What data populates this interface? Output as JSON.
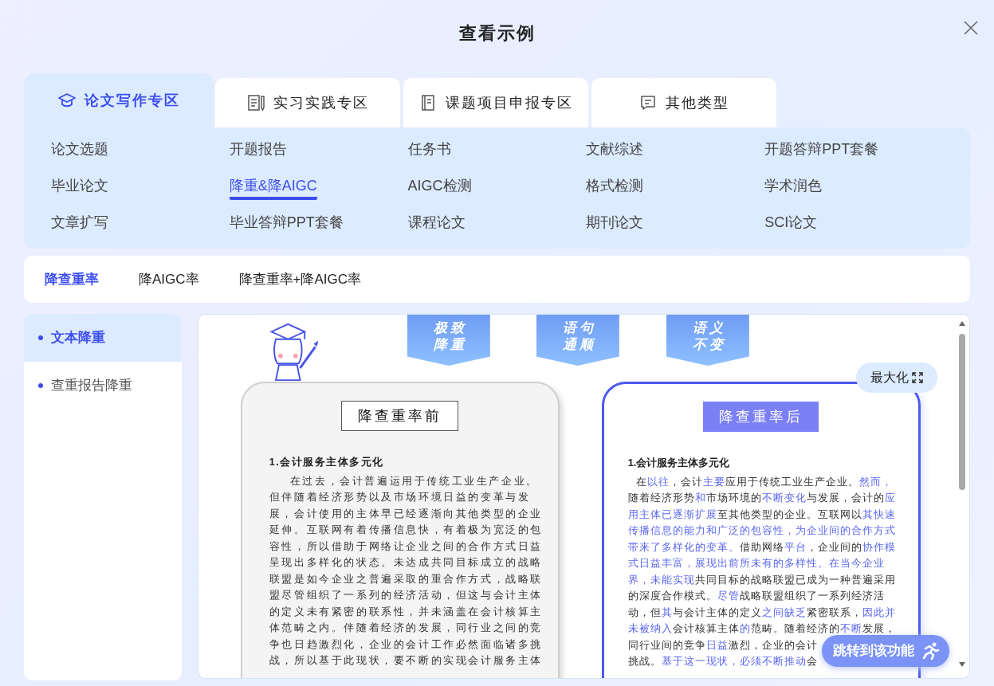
{
  "dialog": {
    "title": "查看示例"
  },
  "tabs": [
    {
      "label": "论文写作专区",
      "kind": "cap",
      "selected": true
    },
    {
      "label": "实习实践专区",
      "kind": "doc",
      "selected": false
    },
    {
      "label": "课题项目申报专区",
      "kind": "book",
      "selected": false
    },
    {
      "label": "其他类型",
      "kind": "chat",
      "selected": false
    }
  ],
  "categories": [
    {
      "label": "论文选题",
      "selected": false
    },
    {
      "label": "开题报告",
      "selected": false
    },
    {
      "label": "任务书",
      "selected": false
    },
    {
      "label": "文献综述",
      "selected": false
    },
    {
      "label": "开题答辩PPT套餐",
      "selected": false
    },
    {
      "label": "毕业论文",
      "selected": false
    },
    {
      "label": "降重&降AIGC",
      "selected": true
    },
    {
      "label": "AIGC检测",
      "selected": false
    },
    {
      "label": "格式检测",
      "selected": false
    },
    {
      "label": "学术润色",
      "selected": false
    },
    {
      "label": "文章扩写",
      "selected": false
    },
    {
      "label": "毕业答辩PPT套餐",
      "selected": false
    },
    {
      "label": "课程论文",
      "selected": false
    },
    {
      "label": "期刊论文",
      "selected": false
    },
    {
      "label": "SCI论文",
      "selected": false
    }
  ],
  "sub_tabs": [
    {
      "label": "降查重率",
      "selected": true
    },
    {
      "label": "降AIGC率",
      "selected": false
    },
    {
      "label": "降查重率+降AIGC率",
      "selected": false
    }
  ],
  "sidebar": {
    "items": [
      {
        "label": "文本降重",
        "selected": true
      },
      {
        "label": "查重报告降重",
        "selected": false
      }
    ]
  },
  "preview": {
    "banners": [
      "极致降重",
      "语句通顺",
      "语义不变"
    ],
    "maximize_button": "最大化",
    "before": {
      "title": "降查重率前",
      "heading": "1.会计服务主体多元化",
      "paragraph": "在过去，会计普遍运用于传统工业生产企业。但伴随着经济形势以及市场环境日益的变革与发展，会计使用的主体早已经逐渐向其他类型的企业延伸。互联网有着传播信息快，有着极为宽泛的包容性，所以借助于网络让企业之间的合作方式日益呈现出多样化的状态。未达成共同目标成立的战略联盟是如今企业之普遍采取的重合作方式，战略联盟尽管组织了一系列的经济活动，但这与会计主体的定义未有紧密的联系性，并未涵盖在会计核算主体范畴之内。伴随着经济的发展，同行业之间的竞争也日趋激烈化，企业的会计工作必然面临诸多挑战，所以基于此现状，要不断的实现会计服务主体"
    },
    "after": {
      "title": "降查重率后",
      "heading": "1.会计服务主体多元化",
      "lines": [
        [
          {
            "text": "在",
            "changed": false
          },
          {
            "text": "以往",
            "changed": true
          },
          {
            "text": "，会计",
            "changed": false
          },
          {
            "text": "主要",
            "changed": true
          },
          {
            "text": "应用于传统工业生产企业。",
            "changed": false
          },
          {
            "text": "然而，",
            "changed": true
          }
        ],
        [
          {
            "text": "随着经济形势",
            "changed": false
          },
          {
            "text": "和",
            "changed": true
          },
          {
            "text": "市场环境的",
            "changed": false
          },
          {
            "text": "不断变化",
            "changed": true
          },
          {
            "text": "与发展，会计的",
            "changed": false
          },
          {
            "text": "应",
            "changed": true
          }
        ],
        [
          {
            "text": "用主体已逐渐扩展",
            "changed": true
          },
          {
            "text": "至其他类型的企业。互联网以",
            "changed": false
          },
          {
            "text": "其快速",
            "changed": true
          }
        ],
        [
          {
            "text": "传播信息的能力和广泛的包容性，为企业间的合作方式",
            "changed": true
          }
        ],
        [
          {
            "text": "带来了多样化的变革。",
            "changed": true
          },
          {
            "text": "借助网络",
            "changed": false
          },
          {
            "text": "平台",
            "changed": true
          },
          {
            "text": "，企业间的",
            "changed": false
          },
          {
            "text": "协作模",
            "changed": true
          }
        ],
        [
          {
            "text": "式日益丰富，展现出前所未有的多样性。在当今企业",
            "changed": true
          }
        ],
        [
          {
            "text": "界，未能实现",
            "changed": true
          },
          {
            "text": "共同目标的战略联盟已成为一种普遍采用",
            "changed": false
          }
        ],
        [
          {
            "text": "的深度合作模式。",
            "changed": false
          },
          {
            "text": "尽管",
            "changed": true
          },
          {
            "text": "战略联盟组织了一系列经济活",
            "changed": false
          }
        ],
        [
          {
            "text": "动，但",
            "changed": false
          },
          {
            "text": "其",
            "changed": true
          },
          {
            "text": "与会计主体的定义",
            "changed": false
          },
          {
            "text": "之间缺乏",
            "changed": true
          },
          {
            "text": "紧密联系，",
            "changed": false
          },
          {
            "text": "因此并",
            "changed": true
          }
        ],
        [
          {
            "text": "未被纳入",
            "changed": true
          },
          {
            "text": "会计核算主体",
            "changed": false
          },
          {
            "text": "的",
            "changed": true
          },
          {
            "text": "范畴。随着经济的",
            "changed": false
          },
          {
            "text": "不断",
            "changed": true
          },
          {
            "text": "发展，",
            "changed": false
          }
        ],
        [
          {
            "text": "同行业间的竞争",
            "changed": false
          },
          {
            "text": "日益",
            "changed": true
          },
          {
            "text": "激烈，企业的会计",
            "changed": false
          }
        ],
        [
          {
            "text": "挑战。",
            "changed": false
          },
          {
            "text": "基于这一现状，必须不断推动",
            "changed": true
          },
          {
            "text": "会",
            "changed": false
          }
        ]
      ]
    },
    "jump_button": "跳转到该功能"
  }
}
